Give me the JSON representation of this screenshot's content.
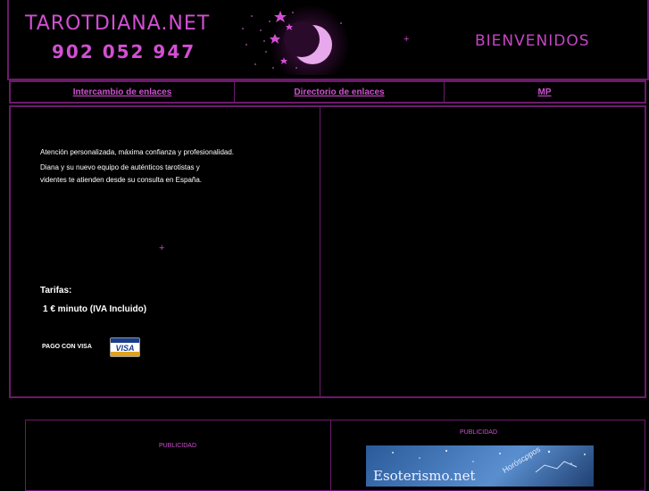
{
  "header": {
    "site_title": "TAROTDIANA.NET",
    "phone": "902 052 947",
    "welcome": "BIENVENIDOS"
  },
  "nav": {
    "items": [
      {
        "label": "Intercambio de enlaces"
      },
      {
        "label": "Directorio de enlaces"
      },
      {
        "label": "MP"
      }
    ]
  },
  "main": {
    "intro_lines": [
      "Atención personalizada, máxima confianza y profesionalidad.",
      "Diana y su nuevo equipo de auténticos tarotistas y",
      "videntes te atienden desde su consulta en España."
    ],
    "rates_title": "Tarifas:",
    "rates_value": "1 € minuto (IVA Incluido)",
    "pay_label": "PAGO CON VISA",
    "visa_text": "VISA"
  },
  "ads": {
    "label_1": "PUBLICIDAD",
    "label_2": "PUBLICIDAD",
    "banner_title": "Esoterismo.net",
    "banner_sub": "Horóscopos"
  },
  "colors": {
    "accent": "#d24fd2",
    "border": "#6b1a6b",
    "background": "#000000"
  }
}
